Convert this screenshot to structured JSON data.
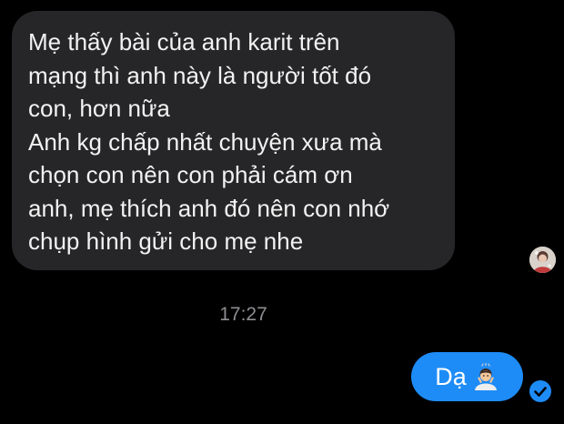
{
  "thread": {
    "incoming_message": {
      "lines": [
        "Mẹ thấy bài của anh karit trên",
        "mạng thì anh này là người tốt đó",
        "con, hơn nữa",
        "Anh kg chấp nhất chuyện xưa mà",
        "chọn con nên con phải cám ơn",
        "anh, mẹ thích anh đó nên con nhớ",
        "chụp hình gửi cho mẹ nhe"
      ],
      "avatar_icon": "contact-avatar-icon",
      "bubble_color": "#262628"
    },
    "timestamp": "17:27",
    "outgoing_message": {
      "text": "Dạ",
      "emoji_icon": "gesturing-person-emoji-icon",
      "bubble_color": "#1e8cf7"
    },
    "read_receipt_icon": "checkmark-circle-icon"
  }
}
